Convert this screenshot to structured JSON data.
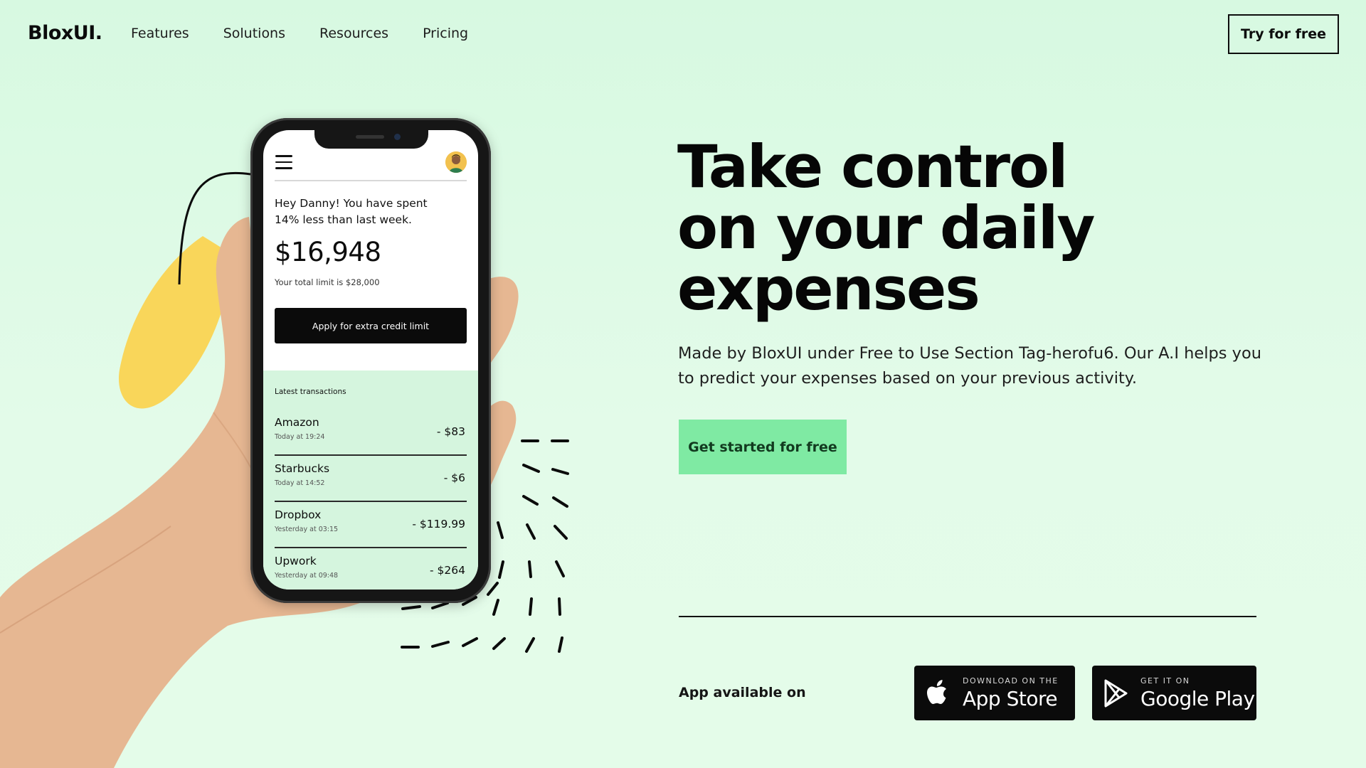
{
  "nav": {
    "logo": "BloxUI.",
    "links": [
      "Features",
      "Solutions",
      "Resources",
      "Pricing"
    ],
    "cta": "Try for free"
  },
  "hero": {
    "title_lines": [
      "Take control",
      "on your daily",
      "expenses"
    ],
    "subtitle": "Made by BloxUI under Free to Use Section Tag-herofu6. Our A.I helps you to predict your expenses based on your previous activity.",
    "cta": "Get started for free"
  },
  "apps": {
    "label": "App available on",
    "app_store": {
      "small": "DOWNLOAD ON THE",
      "big": "App Store",
      "icon": "apple-icon"
    },
    "google_play": {
      "small": "GET IT ON",
      "big": "Google Play",
      "icon": "play-icon"
    }
  },
  "phone": {
    "greeting": "Hey Danny! You have spent 14% less than last week.",
    "balance": "$16,948",
    "limit_text": "Your total limit is $28,000",
    "apply_button": "Apply for extra credit limit",
    "transactions_heading": "Latest transactions",
    "transactions": [
      {
        "name": "Amazon",
        "time": "Today at 19:24",
        "amount": "- $83"
      },
      {
        "name": "Starbucks",
        "time": "Today at 14:52",
        "amount": "- $6"
      },
      {
        "name": "Dropbox",
        "time": "Yesterday at 03:15",
        "amount": "- $119.99"
      },
      {
        "name": "Upwork",
        "time": "Yesterday at 09:48",
        "amount": "- $264"
      }
    ]
  },
  "colors": {
    "background": "#d7f9e1",
    "accent_green": "#7feaa3",
    "blob_yellow": "#f9d65a",
    "text_dark": "#0d0d0d"
  }
}
